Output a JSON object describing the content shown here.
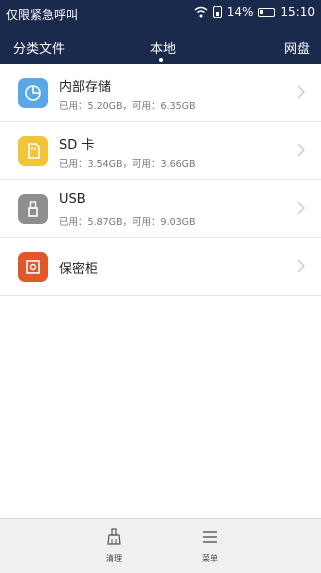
{
  "status_bar": {
    "carrier": "仅限紧急呼叫",
    "battery": "14%",
    "time": "15:10",
    "icons": [
      "wifi-icon",
      "sim-icon",
      "battery-icon"
    ]
  },
  "tabs": [
    {
      "label": "分类文件"
    },
    {
      "label": "本地",
      "selected": true
    },
    {
      "label": "网盘"
    }
  ],
  "storage_list": [
    {
      "title": "内部存储",
      "details": "已用：5.20GB，可用：6.35GB",
      "icon": "pie-chart-icon",
      "color": "#5aa7e8"
    },
    {
      "title": "SD 卡",
      "details": "已用：3.54GB，可用：3.66GB",
      "icon": "sd-card-icon",
      "color": "#f2c43a"
    },
    {
      "title": "USB",
      "details": "已用：5.87GB，可用：9.03GB",
      "icon": "usb-icon",
      "color": "#8e8e8e"
    },
    {
      "title": "保密柜",
      "icon": "safe-icon",
      "color": "#e0582a"
    }
  ],
  "bottom_bar": {
    "clean_label": "清理",
    "menu_label": "菜单",
    "icons": [
      "broom-icon",
      "menu-icon"
    ]
  },
  "colors": {
    "header_bg": "#1a2a4d",
    "bottom_bg": "#f0f0f0"
  }
}
